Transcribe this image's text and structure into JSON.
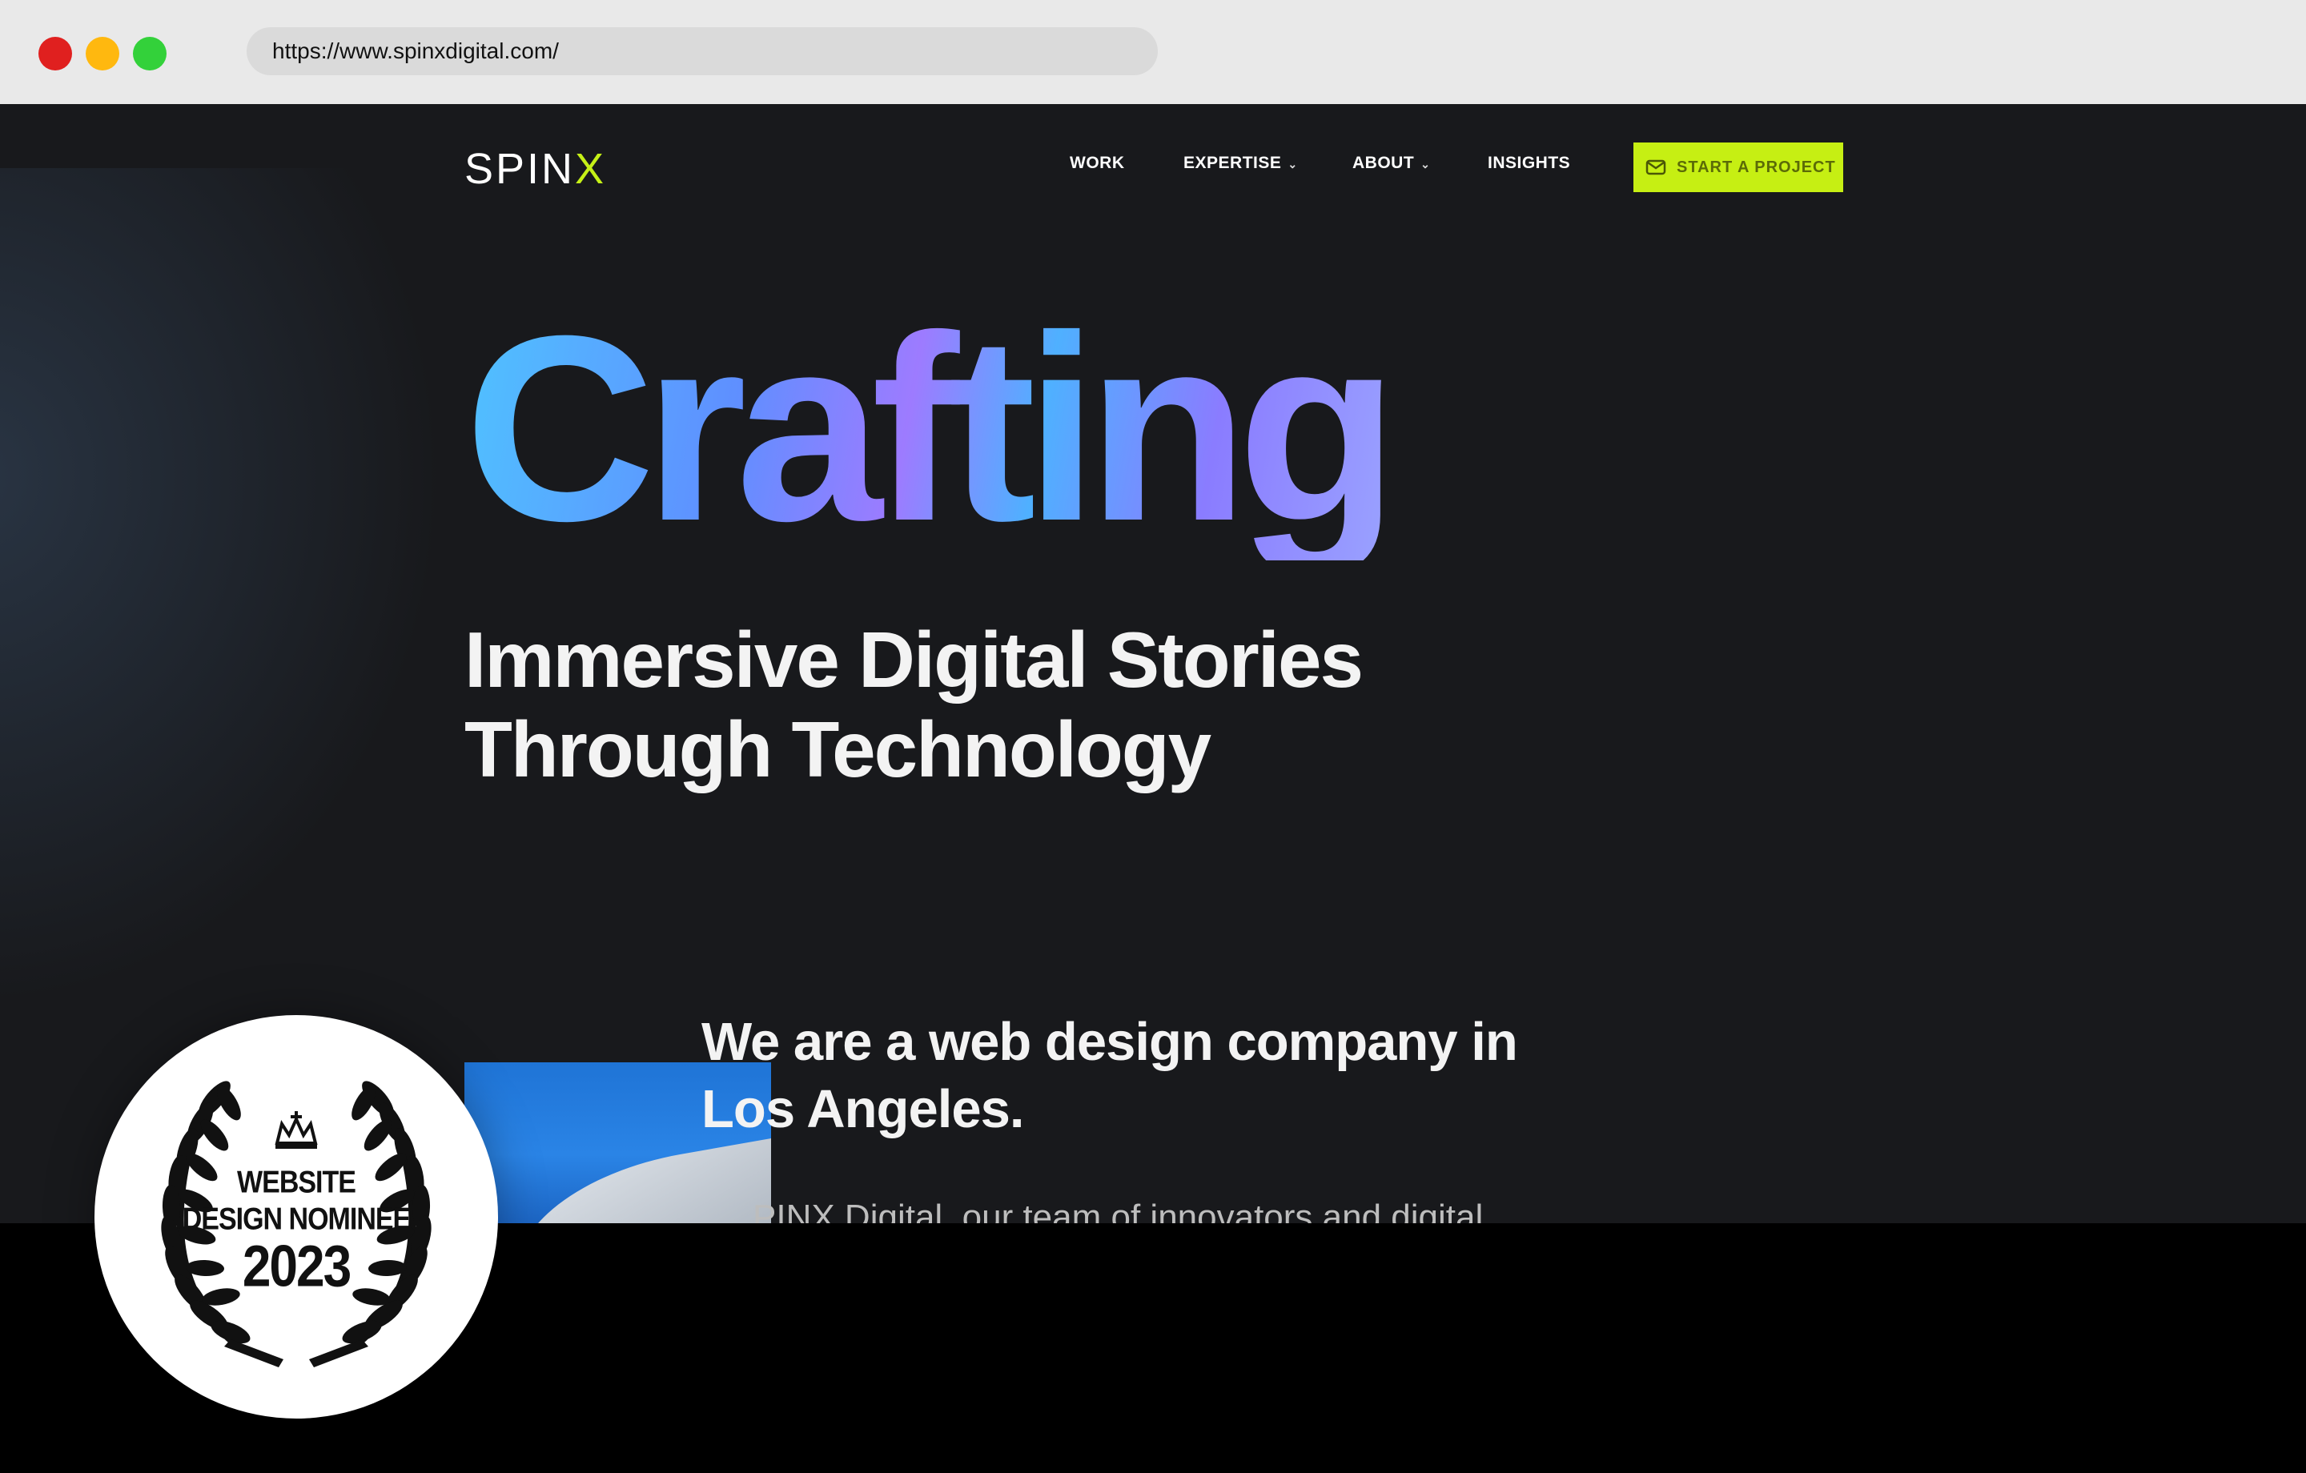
{
  "browser": {
    "url": "https://www.spinxdigital.com/"
  },
  "site": {
    "logo_main": "SPIN",
    "logo_accent": "X",
    "nav": {
      "work": "WORK",
      "expertise": "EXPERTISE",
      "about": "ABOUT",
      "insights": "INSIGHTS"
    },
    "cta_label": "START A PROJECT",
    "accent_color": "#c6ef13",
    "background_color": "#18191c"
  },
  "hero": {
    "headline": "Crafting",
    "subheadline_line1": "Immersive Digital Stories",
    "subheadline_line2": "Through Technology"
  },
  "intro": {
    "title_line1": "We are a web design company in",
    "title_line2": "Los Angeles.",
    "body_partial": "PINX Digital, our team of innovators and digital"
  },
  "badge": {
    "line1": "WEBSITE",
    "line2": "DESIGN NOMINEE",
    "year": "2023"
  },
  "icons": {
    "cta_icon": "mail-icon",
    "badge_icon": "crown-icon"
  }
}
